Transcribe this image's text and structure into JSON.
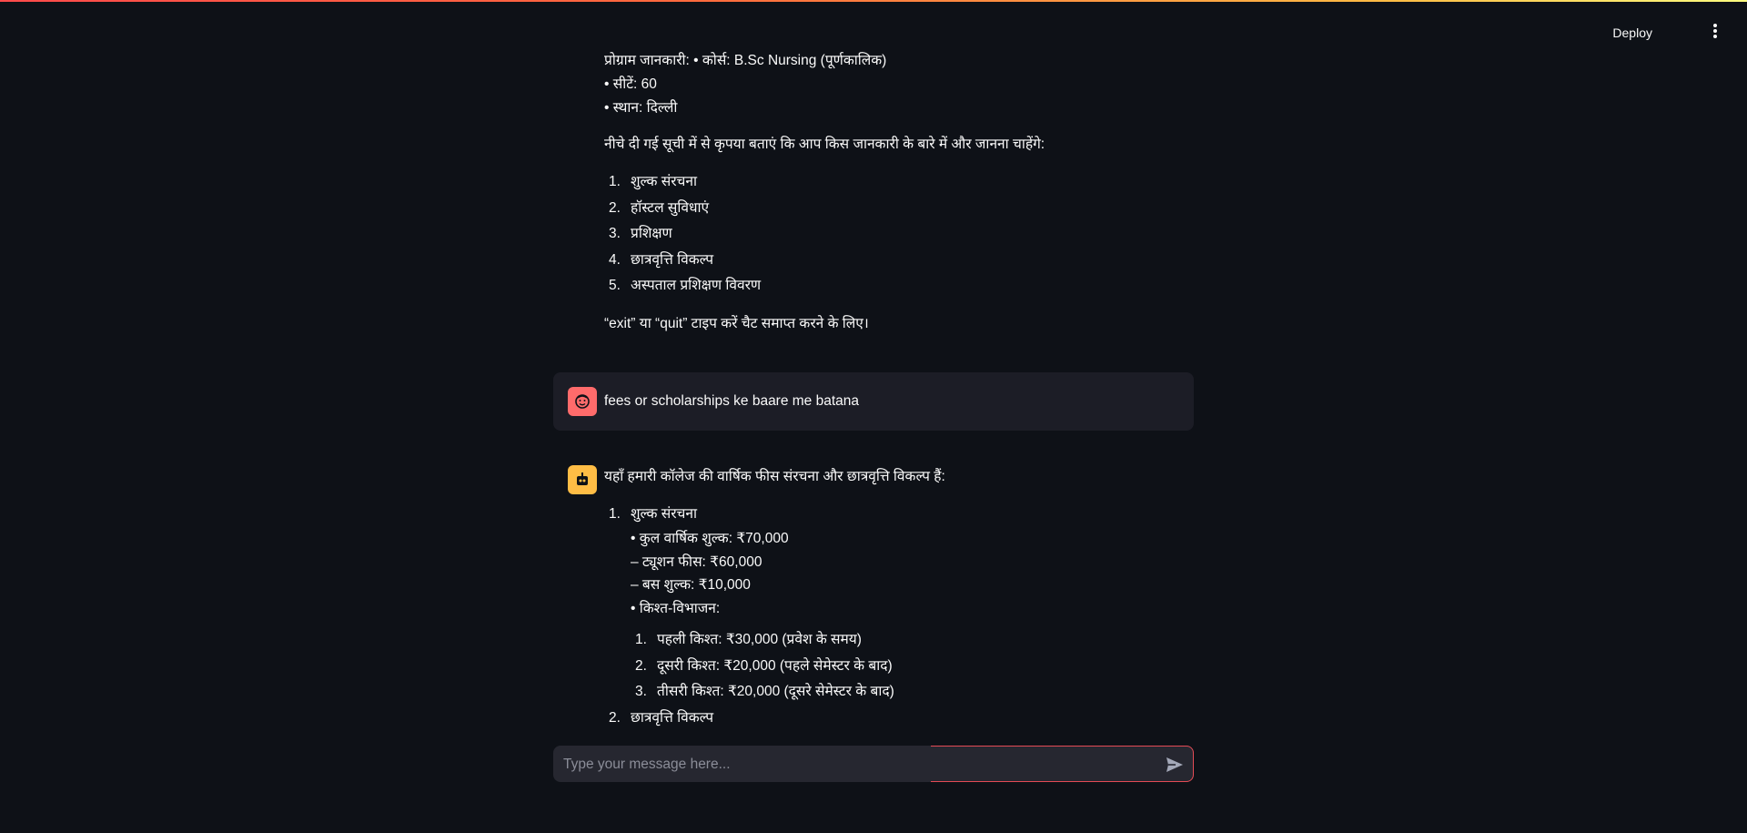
{
  "header": {
    "deploy_label": "Deploy"
  },
  "chat": {
    "messages": [
      {
        "role": "assistant",
        "lines": [
          "प्रोग्राम जानकारी: • कोर्स: B.Sc Nursing (पूर्णकालिक)",
          "• सीटें: 60",
          "• स्थान: दिल्ली"
        ],
        "prompt": "नीचे दी गई सूची में से कृपया बताएं कि आप किस जानकारी के बारे में और जानना चाहेंगे:",
        "options": [
          {
            "num": "1.",
            "label": "शुल्क संरचना"
          },
          {
            "num": "2.",
            "label": "हॉस्टल सुविधाएं"
          },
          {
            "num": "3.",
            "label": "प्रशिक्षण"
          },
          {
            "num": "4.",
            "label": "छात्रवृत्ति विकल्प"
          },
          {
            "num": "5.",
            "label": "अस्पताल प्रशिक्षण विवरण"
          }
        ],
        "footer": "“exit” या “quit” टाइप करें चैट समाप्त करने के लिए।"
      },
      {
        "role": "user",
        "text": "fees or scholarships ke baare me batana"
      },
      {
        "role": "assistant",
        "intro": "यहाँ हमारी कॉलेज की वार्षिक फीस संरचना और छात्रवृत्ति विकल्प हैं:",
        "items": [
          {
            "num": "1.",
            "label": "शुल्क संरचना",
            "details": [
              "• कुल वार्षिक शुल्क: ₹70,000",
              "– ट्यूशन फीस: ₹60,000",
              "– बस शुल्क: ₹10,000",
              "• किश्त-विभाजन:"
            ],
            "installments": [
              {
                "num": "1.",
                "label": "पहली किश्त: ₹30,000 (प्रवेश के समय)"
              },
              {
                "num": "2.",
                "label": "दूसरी किश्त: ₹20,000 (पहले सेमेस्टर के बाद)"
              },
              {
                "num": "3.",
                "label": "तीसरी किश्त: ₹20,000 (दूसरे सेमेस्टर के बाद)"
              }
            ]
          },
          {
            "num": "2.",
            "label": "छात्रवृत्ति विकल्प"
          }
        ]
      }
    ]
  },
  "input": {
    "placeholder": "Type your message here..."
  },
  "colors": {
    "background": "#0e1117",
    "assistant_avatar": "#ffbd45",
    "user_avatar": "#ff6b6b",
    "user_bubble": "#1c1d26",
    "input_bg": "#262730",
    "focus_border": "#e34b55"
  },
  "icons": {
    "assistant_avatar": "robot-icon",
    "user_avatar": "smiley-face-icon",
    "menu": "vertical-dots-icon",
    "send": "send-icon"
  }
}
